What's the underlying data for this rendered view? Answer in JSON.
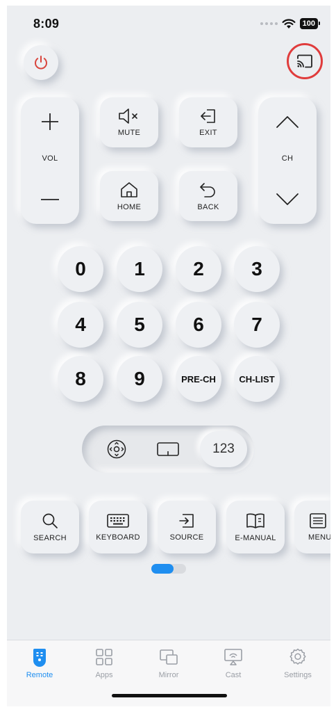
{
  "status": {
    "time": "8:09",
    "battery": "100"
  },
  "controls": {
    "vol_label": "VOL",
    "ch_label": "CH",
    "mute_label": "MUTE",
    "exit_label": "EXIT",
    "home_label": "HOME",
    "back_label": "BACK"
  },
  "numpad": {
    "keys": [
      "0",
      "1",
      "2",
      "3",
      "4",
      "5",
      "6",
      "7",
      "8",
      "9",
      "PRE-CH",
      "CH-LIST"
    ]
  },
  "mode_switch": {
    "numeric_label": "123"
  },
  "tools": {
    "items": [
      "SEARCH",
      "KEYBOARD",
      "SOURCE",
      "E-MANUAL",
      "MENU"
    ]
  },
  "pager": {
    "pages": 2,
    "current": 1
  },
  "tabbar": {
    "items": [
      "Remote",
      "Apps",
      "Mirror",
      "Cast",
      "Settings"
    ],
    "active": "Remote"
  },
  "colors": {
    "accent": "#1f8ef0",
    "power": "#d9453d",
    "highlight_ring": "#e03c3c",
    "background": "#eceef1"
  }
}
